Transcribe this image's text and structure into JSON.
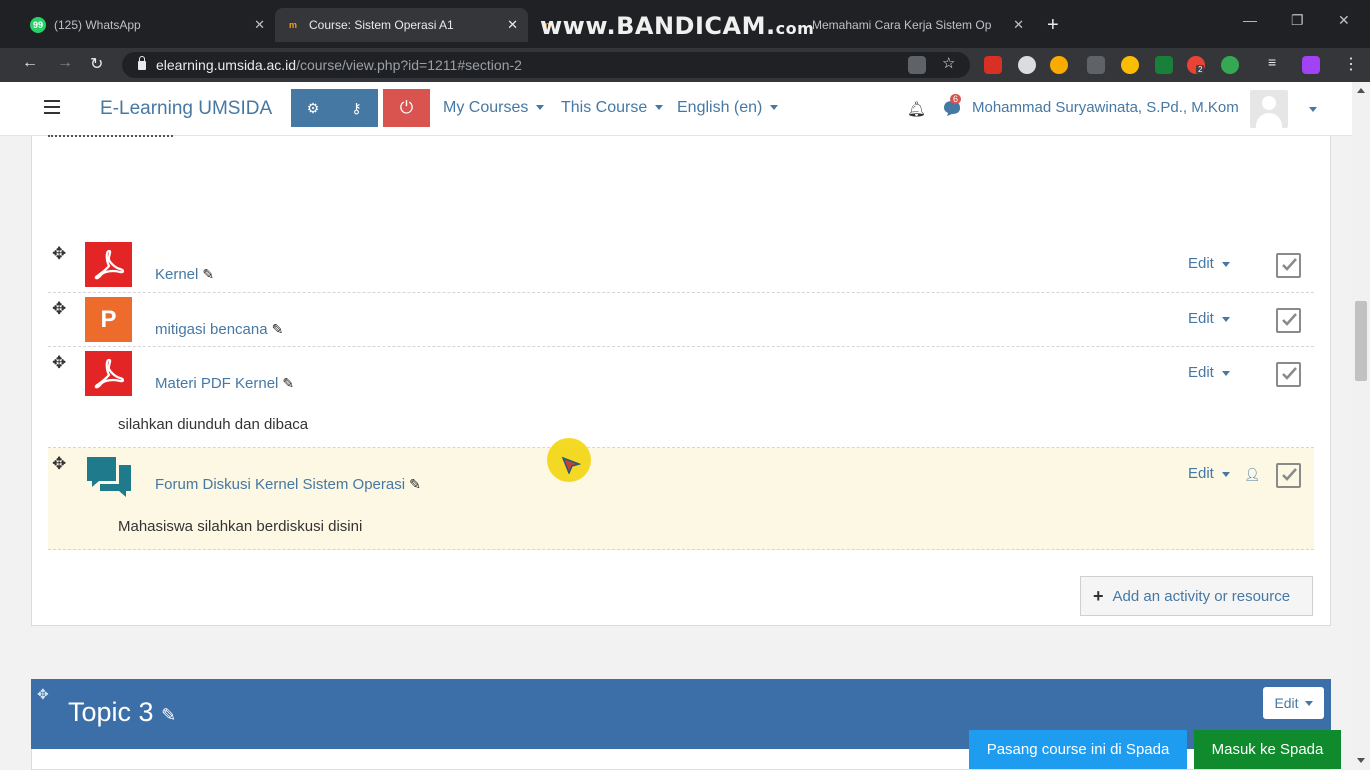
{
  "browser": {
    "tabs": [
      {
        "title": "(125) WhatsApp",
        "active": false,
        "favicon": "whatsapp-icon"
      },
      {
        "title": "Course: Sistem Operasi A1",
        "active": true,
        "favicon": "moodle-icon"
      },
      {
        "title": "Memahami Cara Kerja Sistem Op",
        "active": false,
        "favicon": "moodle-icon"
      }
    ],
    "watermark": {
      "main": "www.BANDICAM.",
      "suffix": "com"
    },
    "url_host": "elearning.umsida.ac.id",
    "url_path": "/course/view.php?id=1211#section-2",
    "extension_badge": "2"
  },
  "navbar": {
    "brand": "E-Learning UMSIDA",
    "menus": [
      "My Courses",
      "This Course",
      "English (en)"
    ],
    "notification_count": "6",
    "user_name": "Mohammad Suryawinata, S.Pd., M.Kom"
  },
  "activities": [
    {
      "name": "Kernel",
      "type": "pdf",
      "icon": "pdf-icon",
      "edit": "Edit",
      "description": ""
    },
    {
      "name": "mitigasi bencana",
      "type": "ppt",
      "icon": "powerpoint-icon",
      "icon_letter": "P",
      "edit": "Edit",
      "description": ""
    },
    {
      "name": "Materi PDF Kernel",
      "type": "pdf",
      "icon": "pdf-icon",
      "edit": "Edit",
      "description": "silahkan diunduh dan dibaca"
    },
    {
      "name": "Forum Diskusi Kernel Sistem Operasi",
      "type": "forum",
      "icon": "forum-icon",
      "edit": "Edit",
      "description": "Mahasiswa silahkan berdiskusi disini",
      "highlighted": true
    }
  ],
  "add_resource_label": "Add an activity or resource",
  "topic3": {
    "title": "Topic 3",
    "edit": "Edit"
  },
  "spada": {
    "install": "Pasang course ini di Spada",
    "login": "Masuk ke Spada"
  },
  "colors": {
    "link": "#4678a4",
    "topic_bar": "#3c6fa8",
    "pdf": "#e32526",
    "ppt": "#ed6c2b",
    "forum": "#1f7a8c",
    "highlight": "#fcf8e3",
    "spada_blue": "#1e9cf0",
    "spada_green": "#0f8a2d"
  }
}
